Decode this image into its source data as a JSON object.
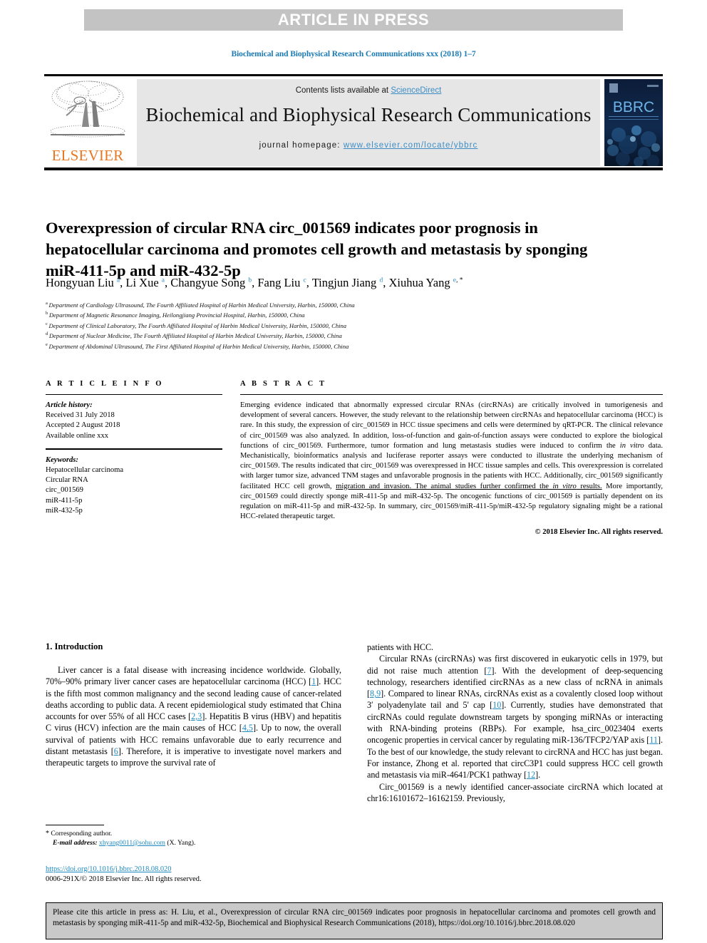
{
  "banner": {
    "label": "ARTICLE IN PRESS"
  },
  "running_head": {
    "text": "Biochemical and Biophysical Research Communications xxx (2018) 1–7"
  },
  "masthead": {
    "contents_prefix": "Contents lists available at ",
    "sciencedirect": "ScienceDirect",
    "journal_title": "Biochemical and Biophysical Research Communications",
    "homepage_prefix": "journal homepage: ",
    "homepage_url": "www.elsevier.com/locate/ybbrc",
    "publisher": "ELSEVIER",
    "cover_mark": "BBRC",
    "accent_orange": "#e87722",
    "accent_blue": "#3c8dc5"
  },
  "article": {
    "title": "Overexpression of circular RNA circ_001569 indicates poor prognosis in hepatocellular carcinoma and promotes cell growth and metastasis by sponging miR-411-5p and miR-432-5p",
    "authors": [
      {
        "name": "Hongyuan Liu",
        "marks": "a",
        "star": false
      },
      {
        "name": "Li Xue",
        "marks": "a",
        "star": false
      },
      {
        "name": "Changyue Song",
        "marks": "b",
        "star": false
      },
      {
        "name": "Fang Liu",
        "marks": "c",
        "star": false
      },
      {
        "name": "Tingjun Jiang",
        "marks": "d",
        "star": false
      },
      {
        "name": "Xiuhua Yang",
        "marks": "e",
        "star": true
      }
    ],
    "affiliations": [
      {
        "mark": "a",
        "text": "Department of Cardiology Ultrasound, The Fourth Affiliated Hospital of Harbin Medical University, Harbin, 150000, China"
      },
      {
        "mark": "b",
        "text": "Department of Magnetic Resonance Imaging, Heilongjiang Provincial Hospital, Harbin, 150000, China"
      },
      {
        "mark": "c",
        "text": "Department of Clinical Laboratory, The Fourth Affiliated Hospital of Harbin Medical University, Harbin, 150000, China"
      },
      {
        "mark": "d",
        "text": "Department of Nuclear Medicine, The Fourth Affiliated Hospital of Harbin Medical University, Harbin, 150000, China"
      },
      {
        "mark": "e",
        "text": "Department of Abdominal Ultrasound, The First Affiliated Hospital of Harbin Medical University, Harbin, 150000, China"
      }
    ]
  },
  "article_info": {
    "heading": "A R T I C L E   I N F O",
    "history_label": "Article history:",
    "history": [
      "Received 31 July 2018",
      "Accepted 2 August 2018",
      "Available online xxx"
    ],
    "keywords_label": "Keywords:",
    "keywords": [
      "Hepatocellular carcinoma",
      "Circular RNA",
      "circ_001569",
      "miR-411-5p",
      "miR-432-5p"
    ]
  },
  "abstract": {
    "heading": "A B S T R A C T",
    "paragraph_1": "Emerging evidence indicated that abnormally expressed circular RNAs (circRNAs) are critically involved in tumorigenesis and development of several cancers. However, the study relevant to the relationship between circRNAs and hepatocellular carcinoma (HCC) is rare. In this study, the expression of circ_001569 in HCC tissue specimens and cells were determined by qRT-PCR. The clinical relevance of circ_001569 was also analyzed. In addition, loss-of-function and gain-of-function assays were conducted to explore the biological functions of circ_001569. Furthermore, tumor formation and lung metastasis studies were induced to confirm the ",
    "italic_1": "in vitro",
    "paragraph_2": " data. Mechanistically, bioinformatics analysis and luciferase reporter assays were conducted to illustrate the underlying mechanism of circ_001569. The results indicated that circ_001569 was overexpressed in HCC tissue samples and cells. This overexpression is correlated with larger tumor size, advanced TNM stages and unfavorable prognosis in the patients with HCC. Additionally, circ_001569 significantly facilitated HCC cell growth, ",
    "underline_1": "migration and invasion. The animal studies further confirmed the ",
    "underline_italic": "in vitro",
    "underline_2": " results.",
    "paragraph_3": " More importantly, circ_001569 could directly sponge miR-411-5p and miR-432-5p. The oncogenic functions of circ_001569 is partially dependent on its regulation on miR-411-5p and miR-432-5p. In summary, circ_001569/miR-411-5p/miR-432-5p regulatory signaling might be a rational HCC-related therapeutic target.",
    "copyright": "© 2018 Elsevier Inc. All rights reserved."
  },
  "introduction": {
    "heading": "1. Introduction",
    "left_p1_a": "Liver cancer is a fatal disease with increasing incidence worldwide. Globally, 70%–90% primary liver cancer cases are hepatocellular carcinoma (HCC) [",
    "ref_1": "1",
    "left_p1_b": "]. HCC is the fifth most common malignancy and the second leading cause of cancer-related deaths according to public data. A recent epidemiological study estimated that China accounts for over 55% of all HCC cases [",
    "ref_23": "2,3",
    "left_p1_c": "]. Hepatitis B virus (HBV) and hepatitis C virus (HCV) infection are the main causes of HCC [",
    "ref_45": "4,5",
    "left_p1_d": "]. Up to now, the overall survival of patients with HCC remains unfavorable due to early recurrence and distant metastasis [",
    "ref_6": "6",
    "left_p1_e": "]. Therefore, it is imperative to investigate novel markers and therapeutic targets to improve the survival rate of",
    "right_p0": "patients with HCC.",
    "right_p1_a": "Circular RNAs (circRNAs) was first discovered in eukaryotic cells in 1979, but did not raise much attention [",
    "ref_7": "7",
    "right_p1_b": "]. With the development of deep-sequencing technology, researchers identified circRNAs as a new class of ncRNA in animals [",
    "ref_89": "8,9",
    "right_p1_c": "]. Compared to linear RNAs, circRNAs exist as a covalently closed loop without 3′ polyadenylate tail and 5' cap [",
    "ref_10": "10",
    "right_p1_d": "]. Currently, studies have demonstrated that circRNAs could regulate downstream targets by sponging miRNAs or interacting with RNA-binding proteins (RBPs). For example, hsa_circ_0023404 exerts oncogenic properties in cervical cancer by regulating miR-136/TFCP2/YAP axis [",
    "ref_11": "11",
    "right_p1_e": "]. To the best of our knowledge, the study relevant to circRNA and HCC has just began. For instance, Zhong et al. reported that circC3P1 could suppress HCC cell growth and metastasis via miR-4641/PCK1 pathway [",
    "ref_12": "12",
    "right_p1_f": "].",
    "right_p2": "Circ_001569 is a newly identified cancer-associate circRNA which located at chr16:16101672–16162159. Previously,"
  },
  "footnote": {
    "star": "*",
    "corresponding": "Corresponding author.",
    "email_label": "E-mail address:",
    "email": "xhyang0011@sohu.com",
    "email_owner": "(X. Yang)."
  },
  "doi_block": {
    "doi": "https://doi.org/10.1016/j.bbrc.2018.08.020",
    "issn_line": "0006-291X/© 2018 Elsevier Inc. All rights reserved."
  },
  "citation_box": {
    "text": "Please cite this article in press as: H. Liu, et al., Overexpression of circular RNA circ_001569 indicates poor prognosis in hepatocellular carcinoma and promotes cell growth and metastasis by sponging miR-411-5p and miR-432-5p, Biochemical and Biophysical Research Communications (2018), https://doi.org/10.1016/j.bbrc.2018.08.020"
  }
}
